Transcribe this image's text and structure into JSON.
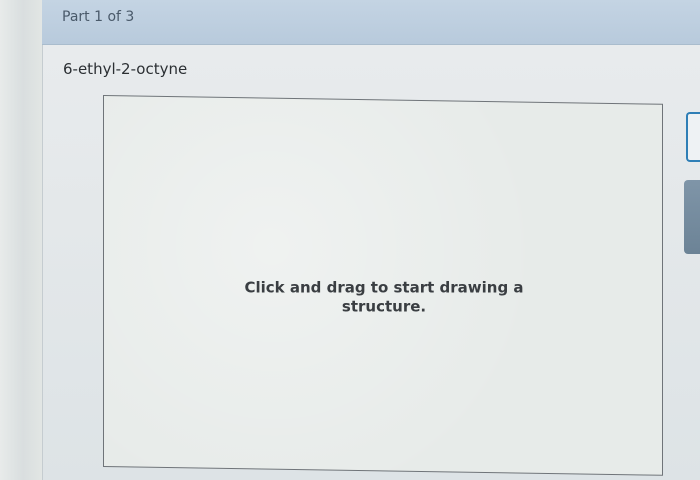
{
  "header": {
    "part_label": "Part 1 of 3"
  },
  "question": {
    "compound_name": "6-ethyl-2-octyne"
  },
  "drawing_canvas": {
    "hint": "Click and drag to start drawing a structure."
  }
}
